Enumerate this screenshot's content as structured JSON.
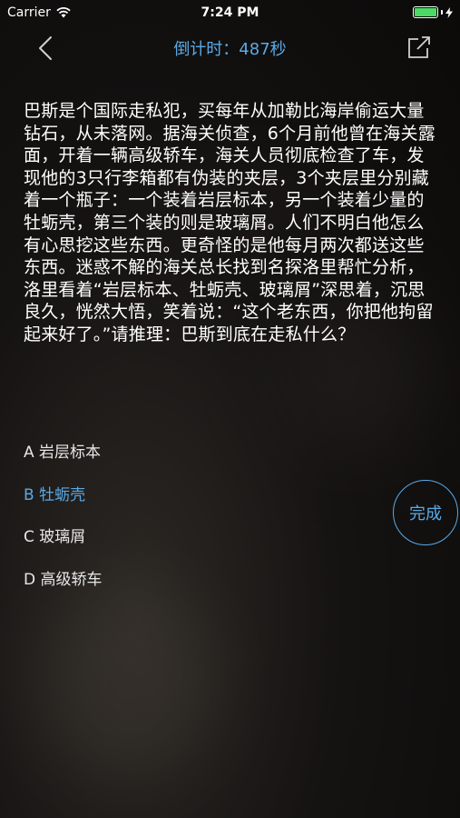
{
  "status_bar": {
    "carrier": "Carrier",
    "time": "7:24 PM",
    "wifi_icon": "wifi-icon",
    "battery_icon": "battery-icon",
    "charging_icon": "bolt-icon"
  },
  "nav": {
    "back_icon": "chevron-left-icon",
    "title": "倒计时：487秒",
    "share_icon": "share-icon"
  },
  "question": {
    "text": "巴斯是个国际走私犯，买每年从加勒比海岸偷运大量钻石，从未落网。据海关侦查，6个月前他曾在海关露面，开着一辆高级轿车，海关人员彻底检查了车，发现他的3只行李箱都有伪装的夹层，3个夹层里分别藏着一个瓶子：一个装着岩层标本，另一个装着少量的牡蛎壳，第三个装的则是玻璃屑。人们不明白他怎么有心思挖这些东西。更奇怪的是他每月两次都送这些东西。迷惑不解的海关总长找到名探洛里帮忙分析，洛里看着“岩层标本、牡蛎壳、玻璃屑”深思着，沉思良久，恍然大悟，笑着说：“这个老东西，你把他拘留起来好了。”请推理：巴斯到底在走私什么？"
  },
  "options": [
    {
      "label": "A 岩层标本",
      "selected": false
    },
    {
      "label": "B 牡蛎壳",
      "selected": true
    },
    {
      "label": "C 玻璃屑",
      "selected": false
    },
    {
      "label": "D 高级轿车",
      "selected": false
    }
  ],
  "done_button": {
    "label": "完成"
  },
  "colors": {
    "accent": "#5aa9e6",
    "battery": "#4cd964"
  }
}
